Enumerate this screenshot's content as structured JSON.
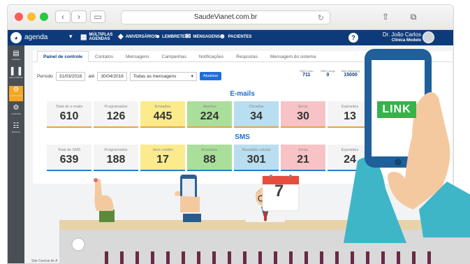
{
  "browser": {
    "url": "SaudeVianet.com.br"
  },
  "header": {
    "brand": "agenda",
    "menu": [
      {
        "icon": "multiple-calendars-icon",
        "label": "MÚLTIPLAS AGENDAS"
      },
      {
        "icon": "birthday-icon",
        "label": "ANIVERSÁRIOS",
        "badge_color": "#e53935"
      },
      {
        "icon": "reminder-icon",
        "label": "LEMBRETES"
      },
      {
        "icon": "messages-icon",
        "label": "MENSAGENS"
      },
      {
        "icon": "patients-icon",
        "label": "PACIENTES"
      }
    ],
    "help": "?",
    "user_name": "Dr. João Carlos",
    "user_clinic": "Clínica Modelo"
  },
  "sidebar": {
    "items": [
      {
        "icon": "agenda-icon",
        "label": "AGENDA"
      },
      {
        "icon": "reports-icon",
        "label": "RELATÓRIOS"
      },
      {
        "icon": "marketing-icon",
        "label": "MARKETING"
      },
      {
        "icon": "settings-icon",
        "label": "AJUSTES"
      },
      {
        "icon": "manual-icon",
        "label": "MANUAL"
      }
    ]
  },
  "tabs": [
    {
      "label": "Painel de controle",
      "active": true
    },
    {
      "label": "Contatos"
    },
    {
      "label": "Mensagens"
    },
    {
      "label": "Campanhas"
    },
    {
      "label": "Notificações"
    },
    {
      "label": "Respostas"
    },
    {
      "label": "Mensagem do sistema"
    }
  ],
  "filters": {
    "period_label": "Período",
    "from": "31/03/2016",
    "until_label": "até",
    "to": "30/04/2016",
    "message_filter": "Todas as mensagens",
    "submit": "Atualizar"
  },
  "credits": [
    {
      "label": "SMS Curto",
      "value": "711"
    },
    {
      "label": "SMS Longo",
      "value": "0"
    },
    {
      "label": "Mail Marketing",
      "value": "15000"
    }
  ],
  "emails": {
    "title": "E-mails",
    "cards": [
      {
        "label": "Total de e-mails",
        "value": "610",
        "bg": "#f4f4f4",
        "bar": "#e8a23a"
      },
      {
        "label": "Programados",
        "value": "126",
        "bg": "#f4f4f4",
        "bar": "#e8a23a"
      },
      {
        "label": "Enviados",
        "value": "445",
        "bg": "#fbeb8c",
        "bar": "#e8a23a"
      },
      {
        "label": "Abertos",
        "value": "224",
        "bg": "#a9df9a",
        "bar": "#e8a23a"
      },
      {
        "label": "Clicados",
        "value": "34",
        "bg": "#b9def0",
        "bar": "#e8a23a"
      },
      {
        "label": "Erros",
        "value": "30",
        "bg": "#f7c3c6",
        "bar": "#e8a23a"
      },
      {
        "label": "Expirados",
        "value": "13",
        "bg": "#f4f4f4",
        "bar": "#e8a23a"
      }
    ]
  },
  "sms": {
    "title": "SMS",
    "cards": [
      {
        "label": "Total de SMS",
        "value": "639",
        "bg": "#f4f4f4",
        "bar": "#2a7bd4"
      },
      {
        "label": "Programados",
        "value": "188",
        "bg": "#f4f4f4",
        "bar": "#2a7bd4"
      },
      {
        "label": "Sem crédito",
        "value": "17",
        "bg": "#fbeb8c",
        "bar": "#2a7bd4"
      },
      {
        "label": "Enviados",
        "value": "88",
        "bg": "#a9df9a",
        "bar": "#2a7bd4"
      },
      {
        "label": "Recebido celular",
        "value": "301",
        "bg": "#b9def0",
        "bar": "#2a7bd4"
      },
      {
        "label": "Erros",
        "value": "21",
        "bg": "#f7c3c6",
        "bar": "#2a7bd4"
      },
      {
        "label": "Expirados",
        "value": "24",
        "bg": "#f4f4f4",
        "bar": "#2a7bd4"
      }
    ]
  },
  "illustration": {
    "phone_button": "LINK",
    "calendar_day": "7"
  },
  "footer": {
    "status": "Site Central de A"
  }
}
